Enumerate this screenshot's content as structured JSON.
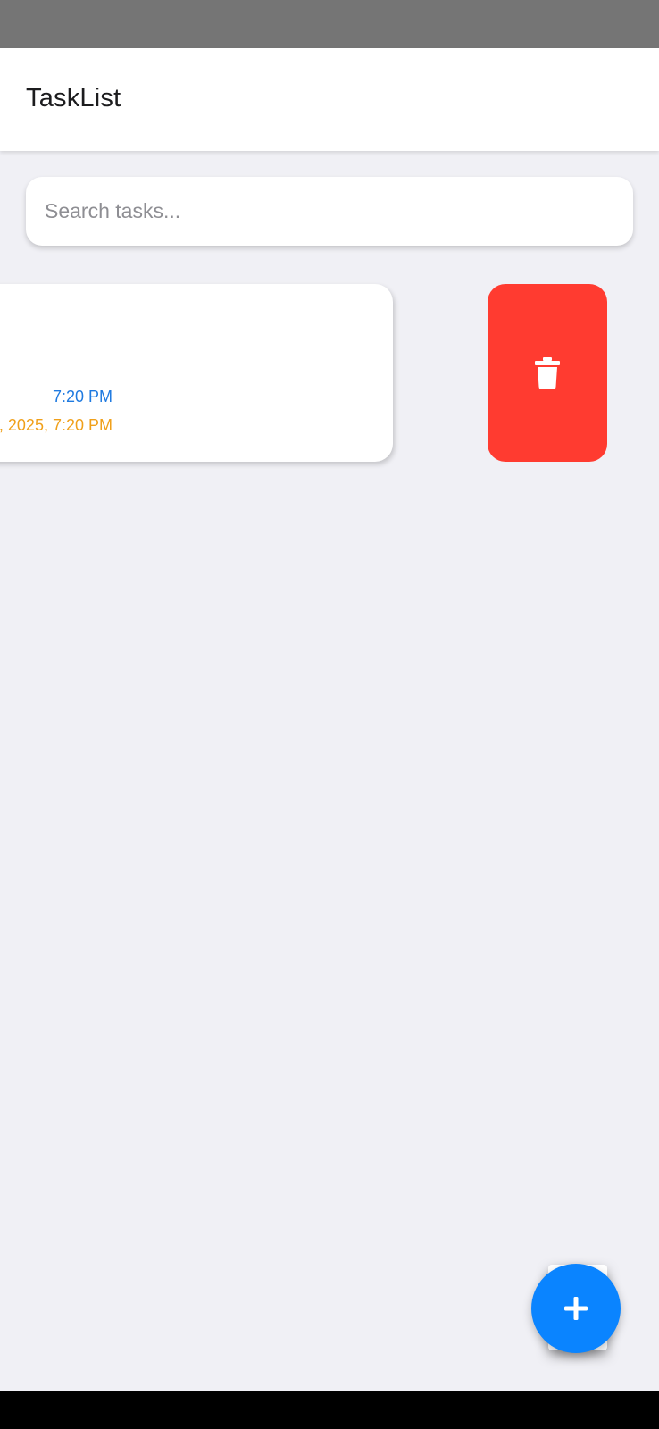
{
  "app": {
    "title": "TaskList"
  },
  "search": {
    "placeholder": "Search tasks...",
    "value": ""
  },
  "tasks": [
    {
      "created_text": "7:20 PM",
      "due_text": ", 2025, 7:20 PM",
      "swipe_action": {
        "icon": "trash-icon",
        "color": "#ff3b30"
      }
    }
  ],
  "fab": {
    "icon": "plus-icon",
    "color": "#0a84ff"
  },
  "colors": {
    "accent": "#0a84ff",
    "danger": "#ff3b30",
    "created_text": "#1f7ae0",
    "due_text": "#f0a01a",
    "background": "#f0f0f5"
  }
}
